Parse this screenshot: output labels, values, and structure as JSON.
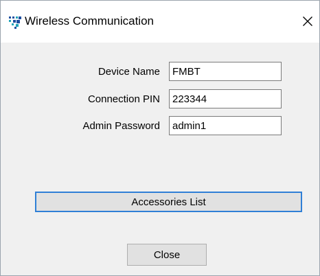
{
  "window": {
    "title": "Wireless Communication",
    "icon": "app-dots-icon",
    "close_glyph": "close-icon"
  },
  "form": {
    "fields": [
      {
        "label": "Device Name",
        "value": "FMBT"
      },
      {
        "label": "Connection PIN",
        "value": "223344"
      },
      {
        "label": "Admin Password",
        "value": "admin1"
      }
    ]
  },
  "buttons": {
    "accessories_label": "Accessories List",
    "close_label": "Close"
  },
  "colors": {
    "focus_border": "#2f7fd6",
    "icon_blue": "#1e4fa0",
    "icon_teal": "#1fa3b8"
  }
}
